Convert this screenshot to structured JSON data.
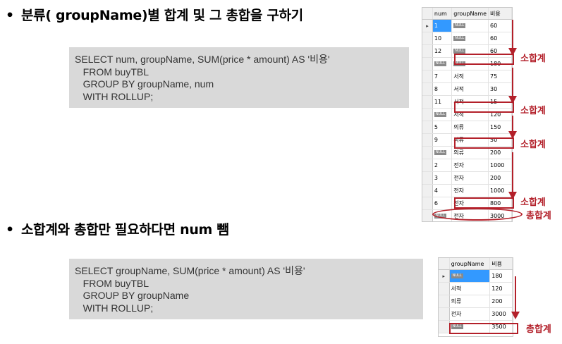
{
  "section1": {
    "bullet": "•",
    "title": "분류( groupName)별 합계 및 그 총합을 구하기",
    "code": [
      "SELECT num, groupName, SUM(price * amount) AS '비용'",
      "   FROM buyTBL",
      "   GROUP BY groupName, num",
      "   WITH ROLLUP;"
    ],
    "result": {
      "columns": [
        "num",
        "groupName",
        "비용"
      ],
      "null_text": "NULL",
      "row_marker": "▸",
      "rows": [
        {
          "num": "1",
          "groupName": null,
          "cost": "60"
        },
        {
          "num": "10",
          "groupName": null,
          "cost": "60"
        },
        {
          "num": "12",
          "groupName": null,
          "cost": "60"
        },
        {
          "num": null,
          "groupName": null,
          "cost": "180"
        },
        {
          "num": "7",
          "groupName": "서적",
          "cost": "75"
        },
        {
          "num": "8",
          "groupName": "서적",
          "cost": "30"
        },
        {
          "num": "11",
          "groupName": "서적",
          "cost": "15"
        },
        {
          "num": null,
          "groupName": "서적",
          "cost": "120"
        },
        {
          "num": "5",
          "groupName": "의류",
          "cost": "150"
        },
        {
          "num": "9",
          "groupName": "의류",
          "cost": "50"
        },
        {
          "num": null,
          "groupName": "의류",
          "cost": "200"
        },
        {
          "num": "2",
          "groupName": "전자",
          "cost": "1000"
        },
        {
          "num": "3",
          "groupName": "전자",
          "cost": "200"
        },
        {
          "num": "4",
          "groupName": "전자",
          "cost": "1000"
        },
        {
          "num": "6",
          "groupName": "전자",
          "cost": "800"
        },
        {
          "num": null,
          "groupName": "전자",
          "cost": "3000"
        },
        {
          "num": null,
          "groupName": null,
          "cost": "3500"
        }
      ]
    },
    "annotations": {
      "subtotal": "소합계",
      "grand_total": "총합계"
    }
  },
  "section2": {
    "bullet": "•",
    "title": "소합계와 총합만 필요하다면 num 뺌",
    "code": [
      "SELECT groupName, SUM(price * amount) AS '비용'",
      "   FROM buyTBL",
      "   GROUP BY groupName",
      "   WITH ROLLUP;"
    ],
    "result": {
      "columns": [
        "groupName",
        "비용"
      ],
      "null_text": "NULL",
      "row_marker": "▸",
      "rows": [
        {
          "groupName": null,
          "cost": "180"
        },
        {
          "groupName": "서적",
          "cost": "120"
        },
        {
          "groupName": "의류",
          "cost": "200"
        },
        {
          "groupName": "전자",
          "cost": "3000"
        },
        {
          "groupName": null,
          "cost": "3500"
        }
      ]
    },
    "annotations": {
      "grand_total": "총합계"
    }
  },
  "colors": {
    "accent": "#b3202a",
    "code_bg": "#d9d9d9",
    "selection": "#3399ff"
  }
}
